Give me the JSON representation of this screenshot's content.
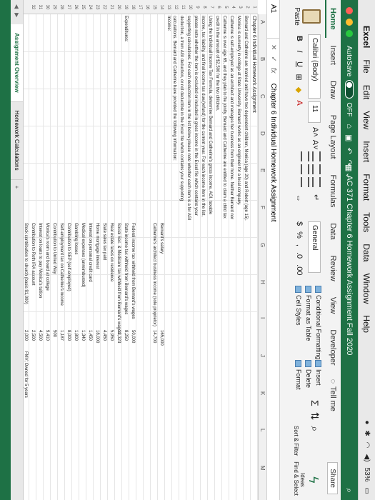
{
  "menubar": {
    "items": [
      "Excel",
      "File",
      "Edit",
      "View",
      "Insert",
      "Format",
      "Tools",
      "Data",
      "Window",
      "Help"
    ],
    "battery": "53%"
  },
  "titlebar": {
    "autosave_label": "AutoSave",
    "autosave_state": "OFF",
    "document_title": "AC 371 Chapter 6 Homework Assignment Fall 2020"
  },
  "ribbon_tabs": {
    "tabs": [
      "Home",
      "Insert",
      "Draw",
      "Page Layout",
      "Formulas",
      "Data",
      "Review",
      "View",
      "Developer"
    ],
    "active": "Home",
    "tell_me": "Tell me",
    "share": "Share"
  },
  "ribbon": {
    "paste_label": "Paste",
    "font_name": "Calibri (Body)",
    "font_size": "11",
    "number_format": "General",
    "conditional_formatting": "Conditional Formatting",
    "format_as_table": "Format as Table",
    "cell_styles": "Cell Styles",
    "insert": "Insert",
    "delete": "Delete",
    "format": "Format",
    "sort_filter": "Sort & Filter",
    "find_select": "Find & Select",
    "ideas": "Ideas"
  },
  "formula_bar": {
    "name_box": "A1",
    "content": "Chapter 6 Individual Homework Assignment"
  },
  "sheet": {
    "column_headers": [
      "A",
      "B",
      "C",
      "D",
      "E",
      "F",
      "G",
      "H",
      "I",
      "J",
      "K",
      "L",
      "M"
    ],
    "row_numbers": [
      "1",
      "2",
      "3",
      "4",
      "5",
      "6",
      "7",
      "8",
      "9",
      "10",
      "11",
      "12",
      "13",
      "14",
      "15",
      "16",
      "17",
      "18",
      "19",
      "20",
      "21",
      "22",
      "23",
      "24",
      "25",
      "26",
      "27",
      "28",
      "29",
      "30",
      "31",
      "32"
    ],
    "a1": "Chapter 6 Individual Homework Assignment",
    "paragraph_1": "Bernard and Catherine are married and have two dependent children, Monica (age 20) and Robert (age 15). Monica is currently in college at State University. Bernard works as an engineer for a local company. Catherine is self-employed as an architect and manages her business from their home. Neither Bernard nor Catherine is over age 65, and they plan to file jointly. Bernard and Catherine are entitled to claim a child tax credit in the amount of $2,500 for the two children.",
    "paragraph_2": "Using the Individual Income Tax Formula, determine Bernard and Catherine's gross income, AGI, taxable income, tax liability, and final income tax due/(refund) for the current year. For each income item in the list, please note whether the item is excluded or included in gross income in the Excel file which contains your supporting calculations. For each deduction item in the list below please note whether each item is a for AGI deduction, a from AGI deduction, or not deductible in the Excel file which contains your supporting calculations. Bernard and Catherine have provided the following information:",
    "income_label": "Income:",
    "expenditures_label": "Expenditures:",
    "income_items": [
      {
        "label": "Bernard's salary",
        "value": "165,000"
      },
      {
        "label": "Catherine's architect business income (sole proprietor)",
        "value": "14,700"
      }
    ],
    "expenditure_items": [
      {
        "label": "Federal income tax withheld from Bernard's wages",
        "value": "50,000"
      },
      {
        "label": "State income tax withheld from Bernard's wages",
        "value": "8,250"
      },
      {
        "label": "Social Sec. & Medicare tax withheld from Bernard's wages",
        "value": "13,323"
      },
      {
        "label": "Real estate taxes on residence",
        "value": "5,950"
      },
      {
        "label": "State sales tax paid",
        "value": "4,450"
      },
      {
        "label": "Home mortgage interest",
        "value": "18,000"
      },
      {
        "label": "Interest on personal credit card",
        "value": "1,450"
      },
      {
        "label": "Medical expenses (unreimbursed)",
        "value": "1,340"
      },
      {
        "label": "Gambling losses",
        "value": "1,800"
      },
      {
        "label": "Contribution to SEP (self-employed)",
        "value": "8,000"
      },
      {
        "label": "Self-employment tax on Catherine's income",
        "value": "1,187"
      },
      {
        "label": "Contribution to United Way",
        "value": "500"
      },
      {
        "label": "Monica's room and board at college",
        "value": "9,410"
      },
      {
        "label": "Interest on loans to pay Monica's tuition",
        "value": "4,500"
      },
      {
        "label": "Contribution to Roth IRA account",
        "value": "2,500"
      },
      {
        "label": "Stock contribution to church (basis $1,000)",
        "value": "2,000",
        "note": "FMV; Owned for 5 years"
      }
    ]
  },
  "sheet_tabs": {
    "tabs": [
      "Assignment Overview",
      "Homework Calculations"
    ],
    "active": "Assignment Overview"
  },
  "colors": {
    "excel_green": "#1e7145",
    "ribbon_bg": "#f3f3f3",
    "menubar_bg": "#e9e9e9"
  }
}
